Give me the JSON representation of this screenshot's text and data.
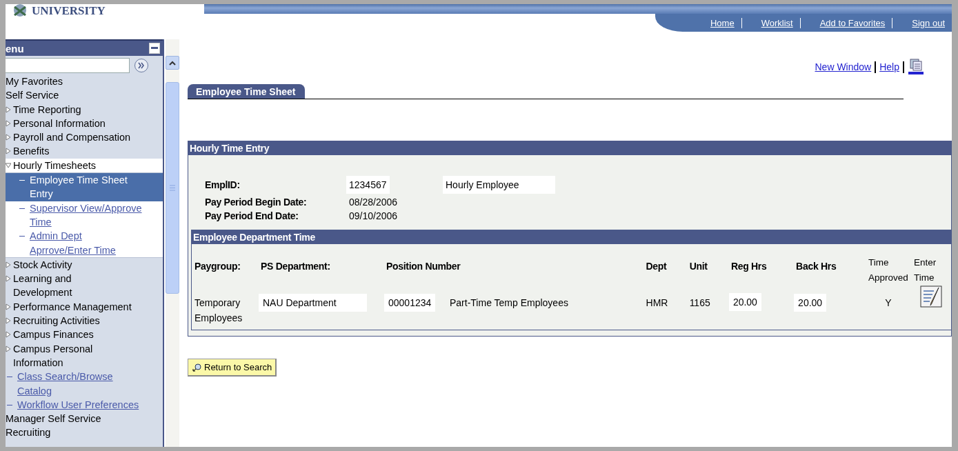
{
  "logo": {
    "text": "UNIVERSITY"
  },
  "nav_links": [
    "Home",
    "Worklist",
    "Add to Favorites",
    "Sign out"
  ],
  "menu": {
    "title": "enu",
    "items": [
      {
        "kind": "heading",
        "label": "My Favorites"
      },
      {
        "kind": "heading",
        "label": "Self Service"
      },
      {
        "kind": "folder",
        "label": "Time Reporting",
        "expanded": false
      },
      {
        "kind": "folder",
        "label": "Personal Information",
        "expanded": false
      },
      {
        "kind": "folder",
        "label": "Payroll and Compensation",
        "expanded": false
      },
      {
        "kind": "folder",
        "label": "Benefits",
        "expanded": false
      },
      {
        "kind": "folder",
        "label": "Hourly Timesheets",
        "expanded": true,
        "children": [
          {
            "kind": "link",
            "label": "Employee Time Sheet\nEntry",
            "selected": true
          },
          {
            "kind": "link",
            "label": "Supervisor View/Approve\nTime",
            "selected": false
          },
          {
            "kind": "link",
            "label": "Admin Dept\nAprrove/Enter Time",
            "selected": false
          }
        ]
      },
      {
        "kind": "folder",
        "label": "Stock Activity",
        "expanded": false
      },
      {
        "kind": "folder",
        "label": "Learning and\nDevelopment",
        "expanded": false
      },
      {
        "kind": "folder",
        "label": "Performance Management",
        "expanded": false
      },
      {
        "kind": "folder",
        "label": "Recruiting Activities",
        "expanded": false
      },
      {
        "kind": "folder",
        "label": "Campus Finances",
        "expanded": false
      },
      {
        "kind": "folder",
        "label": "Campus Personal\nInformation",
        "expanded": false
      },
      {
        "kind": "link",
        "label": "Class Search/Browse\nCatalog",
        "selected": false
      },
      {
        "kind": "link",
        "label": "Workflow User Preferences",
        "selected": false
      },
      {
        "kind": "heading",
        "label": "Manager Self Service"
      },
      {
        "kind": "heading",
        "label": "Recruiting"
      }
    ]
  },
  "page_links": [
    "New Window",
    "Help"
  ],
  "tabs": [
    {
      "label": "Employee Time Sheet",
      "selected": true
    }
  ],
  "hourly_time_entry": {
    "title": "Hourly Time Entry",
    "emplid": {
      "label": "EmplID:",
      "value": "1234567",
      "name": "Hourly Employee"
    },
    "begin_date": {
      "label": "Pay Period Begin Date:",
      "value": "08/28/2006"
    },
    "end_date": {
      "label": "Pay Period End Date:",
      "value": "09/10/2006"
    }
  },
  "department_time": {
    "title": "Employee Department Time",
    "columns": [
      {
        "label": "Paygroup:",
        "bold": true
      },
      {
        "label": "PS Department:",
        "bold": true
      },
      {
        "label": "Position Number",
        "bold": true
      },
      {
        "label": "Dept",
        "bold": true
      },
      {
        "label": "Unit",
        "bold": true
      },
      {
        "label": "Reg Hrs",
        "bold": true
      },
      {
        "label": "Back Hrs",
        "bold": true
      },
      {
        "label": "Time Approved",
        "bold": false
      },
      {
        "label": "Enter Time",
        "bold": false
      }
    ],
    "rows": [
      {
        "paygroup": "Temporary\nEmployees",
        "ps_department": "NAU Department",
        "position_number": "00001234",
        "position_title": "Part-Time Temp Employees",
        "dept": "HMR",
        "unit": "1165",
        "reg_hrs": "20.00",
        "back_hrs": "20.00",
        "time_approved": "Y"
      }
    ]
  },
  "return_button": "Return to Search"
}
